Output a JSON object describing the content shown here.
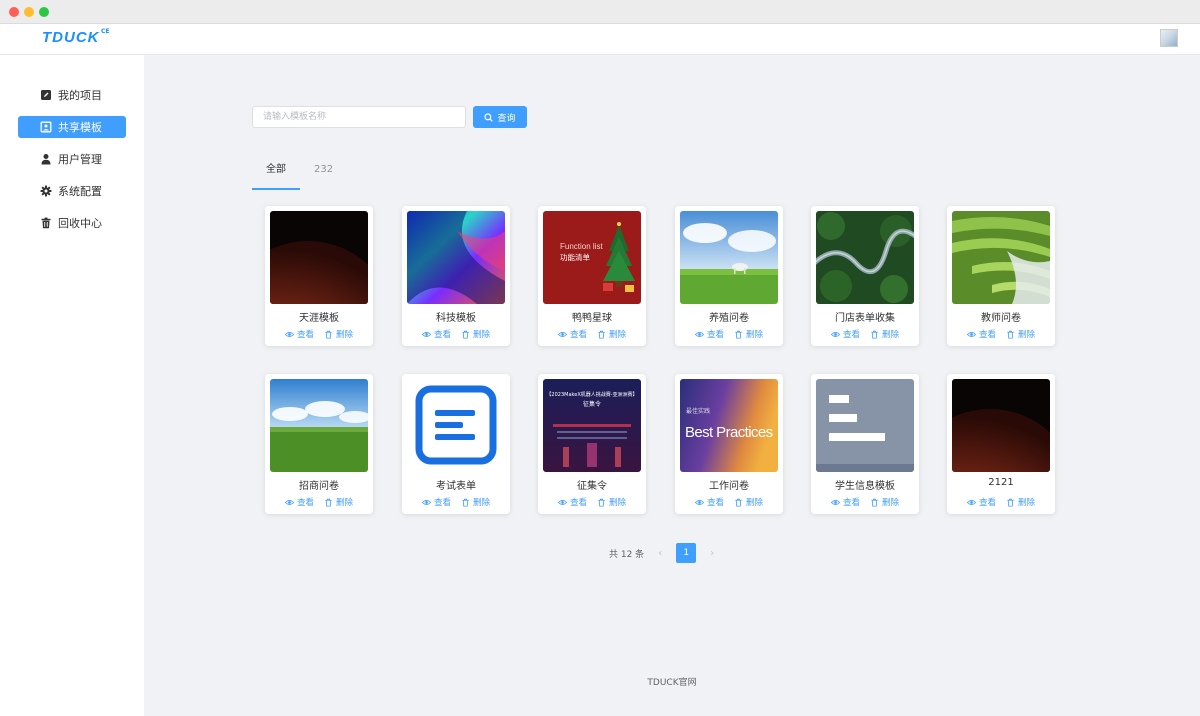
{
  "app": {
    "logo": "TDUCK",
    "logo_sup": "CE"
  },
  "sidebar": {
    "items": [
      {
        "label": "我的项目",
        "icon": "edit-icon",
        "active": false
      },
      {
        "label": "共享模板",
        "icon": "template-icon",
        "active": true
      },
      {
        "label": "用户管理",
        "icon": "user-icon",
        "active": false
      },
      {
        "label": "系统配置",
        "icon": "gear-icon",
        "active": false
      },
      {
        "label": "回收中心",
        "icon": "trash-icon",
        "active": false
      }
    ]
  },
  "search": {
    "placeholder": "请输入模板名称",
    "button_label": "查询"
  },
  "tabs": [
    {
      "label": "全部"
    },
    {
      "label": "232"
    }
  ],
  "templates": [
    {
      "name": "天涯模板"
    },
    {
      "name": "科技模板"
    },
    {
      "name": "鸭鸭星球"
    },
    {
      "name": "养殖问卷"
    },
    {
      "name": "门店表单收集"
    },
    {
      "name": "教师问卷"
    },
    {
      "name": "招商问卷"
    },
    {
      "name": "考试表单"
    },
    {
      "name": "征集令"
    },
    {
      "name": "工作问卷"
    },
    {
      "name": "学生信息模板"
    },
    {
      "name": "2121"
    }
  ],
  "card_actions": {
    "view": "查看",
    "delete": "删除"
  },
  "pagination": {
    "total": "共 12 条",
    "current": "1",
    "prev": "‹",
    "next": "›"
  },
  "footer": {
    "text": "TDUCK官网"
  },
  "image_text": {
    "function_list": "Function list",
    "function_cn": "功能清单",
    "contest_title": "【2023MakeX机器人挑战赛-亚洲洲赛】",
    "contest_sub": "征集令",
    "bp_small": "最佳实践",
    "bp_big": "Best Practices"
  },
  "colors": {
    "accent": "#409eff",
    "brand": "#1890ff"
  }
}
